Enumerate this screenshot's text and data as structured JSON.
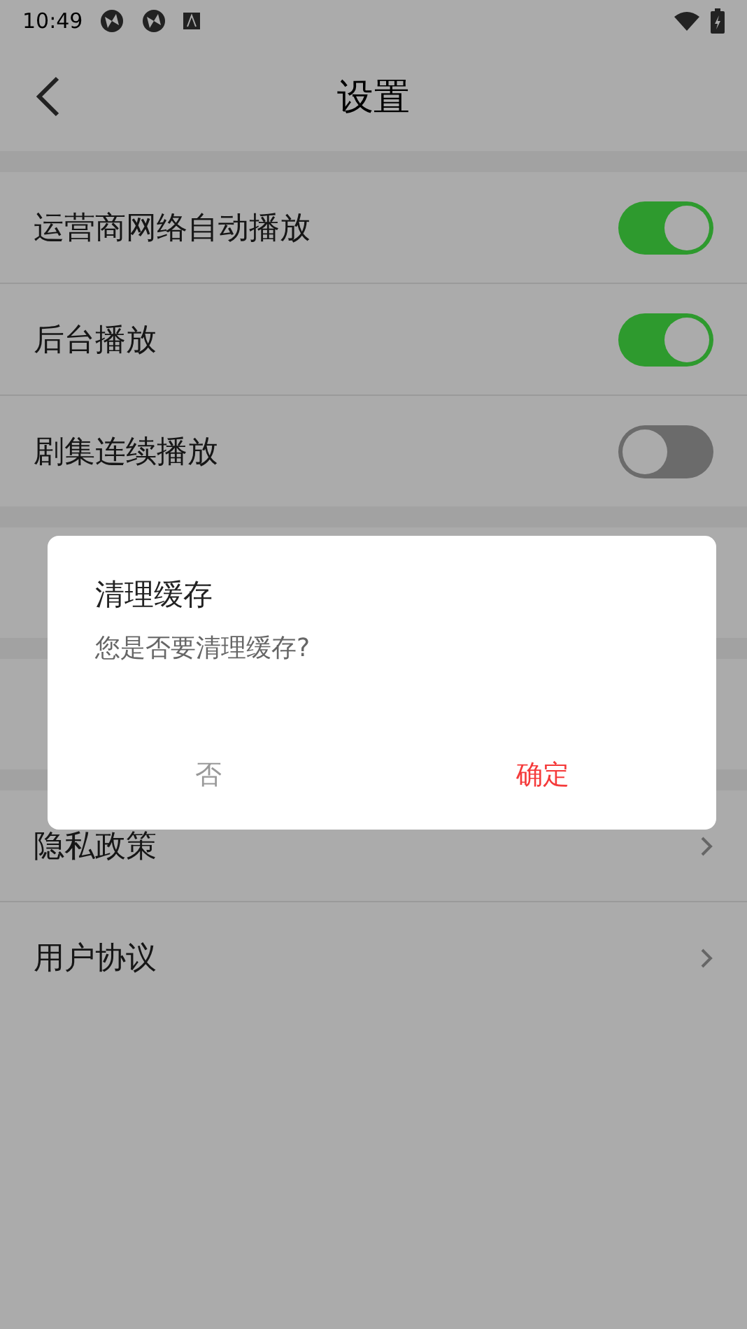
{
  "status_bar": {
    "time": "10:49"
  },
  "header": {
    "title": "设置"
  },
  "sections": [
    {
      "rows": [
        {
          "kind": "toggle",
          "label": "运营商网络自动播放",
          "on": true
        },
        {
          "kind": "toggle",
          "label": "后台播放",
          "on": true
        },
        {
          "kind": "toggle",
          "label": "剧集连续播放",
          "on": false
        }
      ]
    },
    {
      "rows": [
        {
          "kind": "plain"
        }
      ]
    },
    {
      "rows": [
        {
          "kind": "plain"
        }
      ]
    },
    {
      "rows": [
        {
          "kind": "link",
          "label": "隐私政策"
        },
        {
          "kind": "link",
          "label": "用户协议"
        }
      ]
    }
  ],
  "dialog": {
    "title": "清理缓存",
    "message": "您是否要清理缓存?",
    "buttons": [
      {
        "kind": "cancel",
        "label": "否"
      },
      {
        "kind": "confirm",
        "label": "确定"
      }
    ]
  }
}
